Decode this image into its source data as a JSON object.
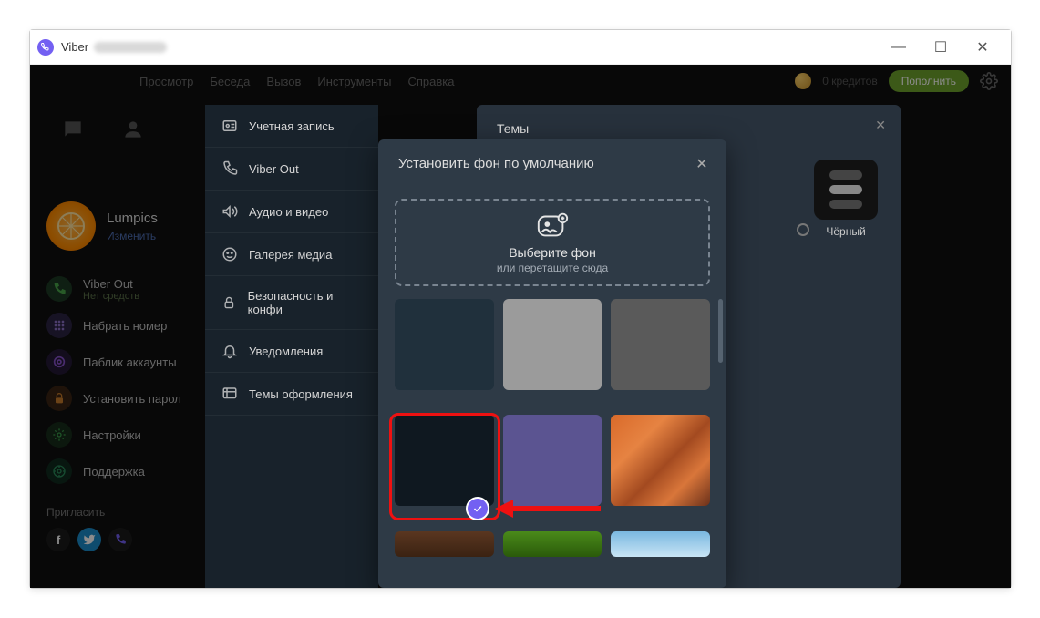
{
  "window": {
    "title": "Viber"
  },
  "topbar": {
    "items": [
      "Просмотр",
      "Беседа",
      "Вызов",
      "Инструменты",
      "Справка"
    ],
    "credits_label": "0 кредитов",
    "topup": "Пополнить"
  },
  "profile": {
    "name": "Lumpics",
    "edit": "Изменить"
  },
  "sidebar": {
    "viber_out": {
      "label": "Viber Out",
      "sub": "Нет средств"
    },
    "dial": "Набрать номер",
    "public": "Паблик аккаунты",
    "password": "Установить парол",
    "settings": "Настройки",
    "support": "Поддержка",
    "invite": "Пригласить"
  },
  "settings_categories": {
    "account": "Учетная запись",
    "viber_out": "Viber Out",
    "av": "Аудио и видео",
    "media": "Галерея медиа",
    "security": "Безопасность и конфи",
    "notifications": "Уведомления",
    "themes": "Темы оформления"
  },
  "themes_modal": {
    "title": "Темы",
    "option_black": "Чёрный"
  },
  "bg_modal": {
    "title": "Установить фон по умолчанию",
    "drop_title": "Выберите фон",
    "drop_sub": "или перетащите сюда"
  }
}
